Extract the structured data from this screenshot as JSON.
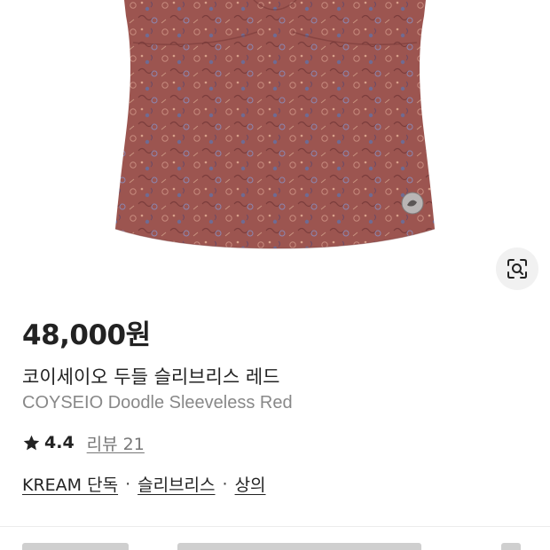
{
  "product": {
    "price": "48,000원",
    "name_ko": "코이세이오 두들 슬리브리스 레드",
    "name_en": "COYSEIO Doodle Sleeveless Red",
    "image_alt": "red doodle pattern sleeveless top",
    "shirt_color": "#9c5550"
  },
  "rating": {
    "icon": "star-icon",
    "score": "4.4",
    "review_label": "리뷰 21"
  },
  "tags": {
    "items": [
      "KREAM 단독",
      "슬리브리스",
      "상의"
    ],
    "separator": "·"
  },
  "lens": {
    "icon": "lens-search-icon"
  }
}
